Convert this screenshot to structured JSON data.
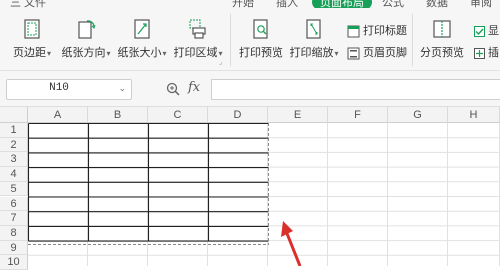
{
  "menubar": {
    "items": [
      {
        "label": "三 文件",
        "active": false
      },
      {
        "label": "开始",
        "active": false
      },
      {
        "label": "插入",
        "active": false
      },
      {
        "label": "页面布局",
        "active": true
      },
      {
        "label": "公式",
        "active": false
      },
      {
        "label": "数据",
        "active": false
      },
      {
        "label": "审阅",
        "active": false
      }
    ]
  },
  "ribbon": {
    "margins": "页边距",
    "orientation": "纸张方向",
    "size": "纸张大小",
    "print_area": "打印区域",
    "print_preview": "打印预览",
    "print_scale": "打印缩放",
    "print_titles": "打印标题",
    "header_footer": "页眉页脚",
    "page_break_preview": "分页预览",
    "show_partial": "显",
    "insert_partial": "插"
  },
  "formula_bar": {
    "name_box": "N10",
    "fx_label": "fx",
    "formula": ""
  },
  "sheet": {
    "columns": [
      "A",
      "B",
      "C",
      "D",
      "E",
      "F",
      "G",
      "H"
    ],
    "rows": [
      "1",
      "2",
      "3",
      "4",
      "5",
      "6",
      "7",
      "8",
      "9",
      "10"
    ]
  },
  "colors": {
    "accent": "#18a058",
    "arrow": "#d9302c"
  }
}
